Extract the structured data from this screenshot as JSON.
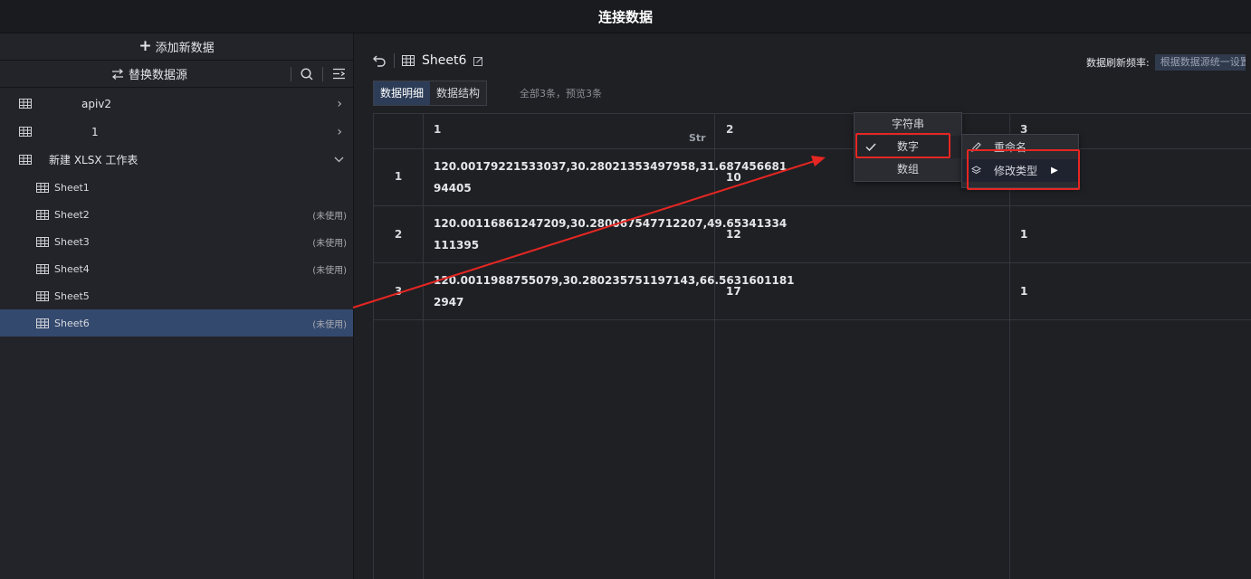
{
  "window": {
    "title": "连接数据"
  },
  "sidebar": {
    "add_label": "添加新数据",
    "replace_label": "替换数据源",
    "sources": [
      {
        "name": "apiv2",
        "expanded": false
      },
      {
        "name": "1",
        "expanded": false
      },
      {
        "name": "新建 XLSX 工作表",
        "expanded": true
      }
    ],
    "sheets": [
      {
        "name": "Sheet1",
        "status": "",
        "active": false
      },
      {
        "name": "Sheet2",
        "status": "(未使用)",
        "active": false
      },
      {
        "name": "Sheet3",
        "status": "(未使用)",
        "active": false
      },
      {
        "name": "Sheet4",
        "status": "(未使用)",
        "active": false
      },
      {
        "name": "Sheet5",
        "status": "",
        "active": false
      },
      {
        "name": "Sheet6",
        "status": "(未使用)",
        "active": true
      }
    ]
  },
  "main": {
    "sheet_name": "Sheet6",
    "refresh_label": "数据刷新频率:",
    "refresh_value": "根据数据源统一设置",
    "tabs": [
      {
        "label": "数据明细",
        "active": true
      },
      {
        "label": "数据结构",
        "active": false
      }
    ],
    "info": "全部3条，预览3条",
    "table": {
      "columns": [
        {
          "name": "1",
          "type_icon": "Str"
        },
        {
          "name": "2",
          "type_icon": ""
        },
        {
          "name": "3",
          "type_icon": ""
        }
      ],
      "rows": [
        {
          "num": "1",
          "c1a": "120.00179221533037,30.28021353497958,31.687456681",
          "c1b": "94405",
          "c2": "10",
          "c3": ""
        },
        {
          "num": "2",
          "c1a": "120.00116861247209,30.280067547712207,49.65341334",
          "c1b": "111395",
          "c2": "12",
          "c3": "1"
        },
        {
          "num": "3",
          "c1a": "120.0011988755079,30.280235751197143,66.5631601181",
          "c1b": "2947",
          "c2": "17",
          "c3": "1"
        }
      ]
    }
  },
  "context_menu_type": {
    "items": [
      {
        "label": "字符串",
        "checked": false
      },
      {
        "label": "数字",
        "checked": true
      },
      {
        "label": "数组",
        "checked": false
      }
    ]
  },
  "context_menu": {
    "items": [
      {
        "label": "重命名",
        "icon": "pencil-icon"
      },
      {
        "label": "修改类型",
        "icon": "layers-icon"
      }
    ]
  },
  "colors": {
    "accent_active": "#34496e",
    "annotation_red": "#e62622"
  }
}
